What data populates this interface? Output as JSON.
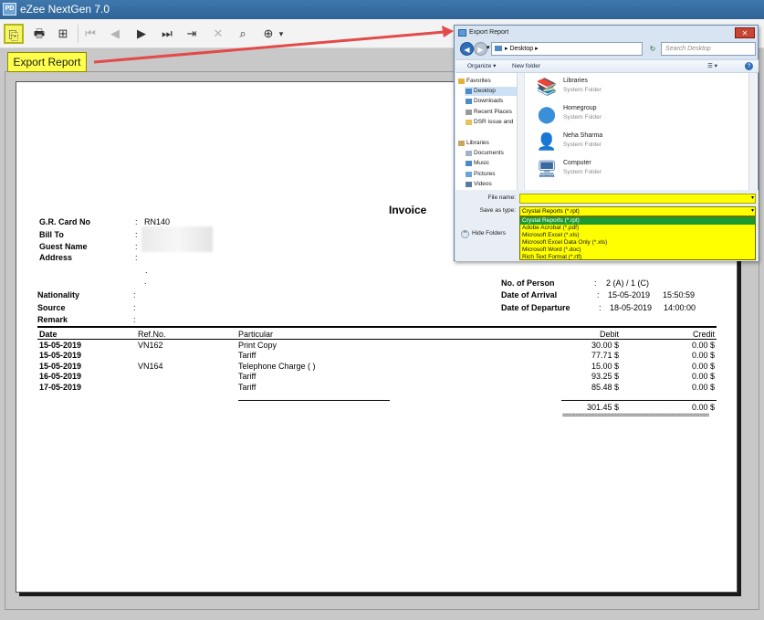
{
  "window": {
    "app_icon": "PD",
    "title": "eZee NextGen 7.0"
  },
  "toolbar": {
    "buttons": [
      {
        "name": "export-report",
        "icon": "export-icon",
        "glyph": "⎘"
      },
      {
        "name": "print",
        "icon": "printer-icon",
        "glyph": "🖶"
      },
      {
        "name": "group-tree",
        "icon": "tree-icon",
        "glyph": "⊞"
      },
      {
        "name": "first-page",
        "icon": "first-page-icon",
        "glyph": "⏮"
      },
      {
        "name": "previous-page",
        "icon": "previous-page-icon",
        "glyph": "◀"
      },
      {
        "name": "next-page",
        "icon": "next-page-icon",
        "glyph": "▶"
      },
      {
        "name": "last-page",
        "icon": "last-page-icon",
        "glyph": "⏭"
      },
      {
        "name": "go-to-page",
        "icon": "go-to-page-icon",
        "glyph": "⇥"
      },
      {
        "name": "stop",
        "icon": "close-icon",
        "glyph": "✕"
      },
      {
        "name": "search",
        "icon": "binoculars-icon",
        "glyph": "⌕"
      },
      {
        "name": "zoom",
        "icon": "zoom-icon",
        "glyph": "⊕"
      }
    ],
    "zoom_dropdown": "▾",
    "tooltip": "Export Report"
  },
  "report": {
    "title": "Invoice",
    "left_fields": [
      {
        "label": "G.R. Card No",
        "value": "RN140"
      },
      {
        "label": "Bill To",
        "value": ""
      },
      {
        "label": "Guest Name",
        "value": ""
      },
      {
        "label": "Address",
        "value": ""
      }
    ],
    "address_dots": [
      ".",
      "."
    ],
    "bottom_left_fields": [
      {
        "label": "Nationality",
        "value": ""
      },
      {
        "label": "Source",
        "value": ""
      },
      {
        "label": "Remark",
        "value": ""
      }
    ],
    "colon": ":",
    "right_fields": [
      {
        "label": "No. of Person",
        "value": "2 (A) / 1 (C)",
        "extra": ""
      },
      {
        "label": "Date of Arrival",
        "value": "15-05-2019",
        "extra": "15:50:59"
      },
      {
        "label": "Date of Departure",
        "value": "18-05-2019",
        "extra": "14:00:00"
      }
    ],
    "columns": [
      "Date",
      "Ref.No.",
      "Particular",
      "Debit",
      "Credit"
    ],
    "rows": [
      {
        "date": "15-05-2019",
        "ref": "VN162",
        "particular": "Print Copy",
        "debit": "30.00 $",
        "credit": "0.00 $"
      },
      {
        "date": "15-05-2019",
        "ref": "",
        "particular": "Tariff",
        "debit": "77.71 $",
        "credit": "0.00 $"
      },
      {
        "date": "15-05-2019",
        "ref": "VN164",
        "particular": "Telephone Charge ( )",
        "debit": "15.00 $",
        "credit": "0.00 $"
      },
      {
        "date": "16-05-2019",
        "ref": "",
        "particular": "Tariff",
        "debit": "93.25 $",
        "credit": "0.00 $"
      },
      {
        "date": "17-05-2019",
        "ref": "",
        "particular": "Tariff",
        "debit": "85.48 $",
        "credit": "0.00 $"
      }
    ],
    "total_debit": "301.45 $",
    "total_credit": "0.00 $",
    "double_rule": "=============================================="
  },
  "dialog": {
    "title": "Export Report",
    "close_glyph": "✕",
    "back_glyph": "◀",
    "forward_glyph": "▶",
    "history_glyph": "▾",
    "address": "Desktop",
    "address_sep": "▸",
    "refresh_glyph": "↻",
    "search_placeholder": "Search Desktop",
    "organize": "Organize ▾",
    "new_folder": "New folder",
    "view_glyph": "☰ ▾",
    "help_glyph": "?",
    "nav_items": [
      {
        "label": "Favorites",
        "icon": "star-icon",
        "color": "#e3b23c",
        "indent": 0,
        "selected": false
      },
      {
        "label": "Desktop",
        "icon": "desktop-icon",
        "color": "#4d8ac9",
        "indent": 1,
        "selected": true
      },
      {
        "label": "Downloads",
        "icon": "downloads-icon",
        "color": "#4d8ac9",
        "indent": 1,
        "selected": false
      },
      {
        "label": "Recent Places",
        "icon": "recent-icon",
        "color": "#9a9a9a",
        "indent": 1,
        "selected": false
      },
      {
        "label": "DSR issue and",
        "icon": "folder-icon",
        "color": "#e6c25a",
        "indent": 1,
        "selected": false
      },
      {
        "label": "Libraries",
        "icon": "libraries-icon",
        "color": "#c9a75a",
        "indent": 0,
        "selected": false
      },
      {
        "label": "Documents",
        "icon": "documents-icon",
        "color": "#9fb4cc",
        "indent": 1,
        "selected": false
      },
      {
        "label": "Music",
        "icon": "music-icon",
        "color": "#4d8ac9",
        "indent": 1,
        "selected": false
      },
      {
        "label": "Pictures",
        "icon": "pictures-icon",
        "color": "#6aa4d9",
        "indent": 1,
        "selected": false
      },
      {
        "label": "Videos",
        "icon": "videos-icon",
        "color": "#5a7aa0",
        "indent": 1,
        "selected": false
      }
    ],
    "files": [
      {
        "name": "Libraries",
        "type": "System Folder",
        "icon": "libraries-folder-icon",
        "glyph": "📚",
        "color": "#d8a94a"
      },
      {
        "name": "Homegroup",
        "type": "System Folder",
        "icon": "homegroup-icon",
        "glyph": "⬤",
        "color": "#3b8ed8"
      },
      {
        "name": "Neha Sharma",
        "type": "System Folder",
        "icon": "user-folder-icon",
        "glyph": "👤",
        "color": "#b08a3e"
      },
      {
        "name": "Computer",
        "type": "System Folder",
        "icon": "computer-icon",
        "glyph": "🖥",
        "color": "#3a6aa3"
      }
    ],
    "file_name_label": "File name:",
    "file_name_value": "",
    "save_type_label": "Save as type:",
    "save_type_value": "Crystal Reports (*.rpt)",
    "dropdown_glyph": "▾",
    "save_type_options": [
      "Crystal Reports (*.rpt)",
      "Adobe Acrobat (*.pdf)",
      "Microsoft Excel (*.xls)",
      "Microsoft Excel Data Only (*.xls)",
      "Microsoft Word (*.doc)",
      "Rich Text Format (*.rtf)"
    ],
    "selected_option_index": 0,
    "hide_folders": "Hide Folders",
    "hide_folders_glyph": "^"
  },
  "colors": {
    "highlight": "#ffff00",
    "arrow": "#e34a4a",
    "selected_option": "#1b9b2f",
    "titlebar": "#3f78ad"
  }
}
